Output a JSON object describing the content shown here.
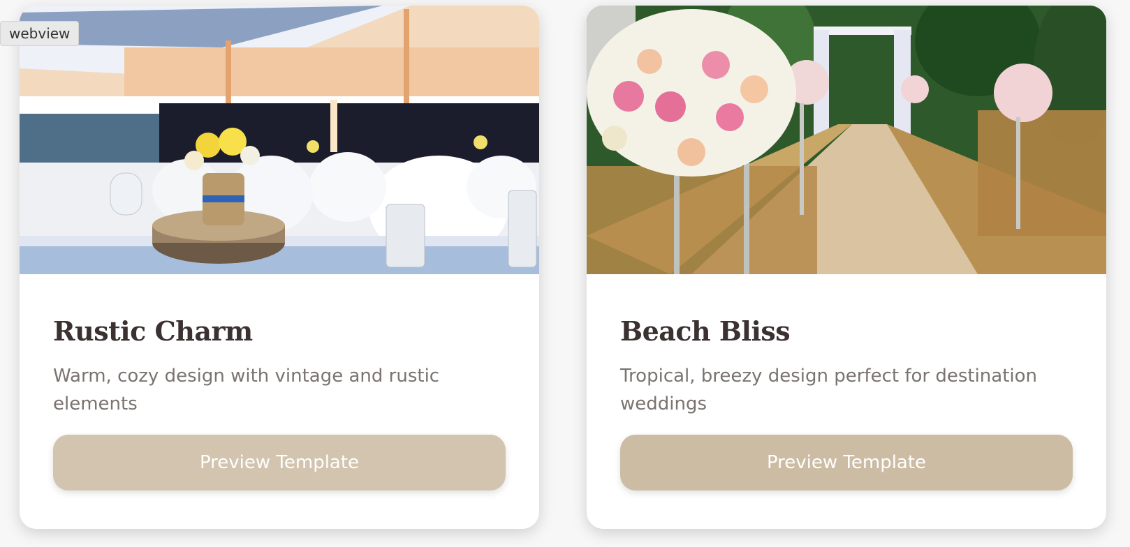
{
  "badge": "webview",
  "cards": [
    {
      "title": "Rustic Charm",
      "description": "Warm, cozy design with vintage and rustic elements",
      "button_label": "Preview Template",
      "image_icon": "rustic-reception-photo"
    },
    {
      "title": "Beach Bliss",
      "description": "Tropical, breezy design perfect for destination weddings",
      "button_label": "Preview Template",
      "image_icon": "floral-aisle-photo"
    }
  ],
  "colors": {
    "button": "#ccbca4",
    "title": "#3a3130",
    "description": "#7a7370"
  }
}
